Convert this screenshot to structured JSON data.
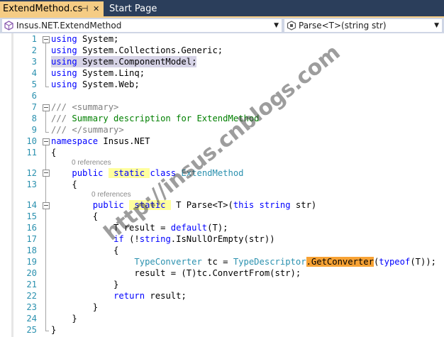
{
  "tabs": [
    {
      "label": "ExtendMethod.cs",
      "active": true,
      "pin_glyph": "⊣",
      "close_glyph": "✕"
    },
    {
      "label": "Start Page",
      "active": false
    }
  ],
  "navbar": {
    "type_dropdown": "Insus.NET.ExtendMethod",
    "member_dropdown": "Parse<T>(string str)"
  },
  "codelens": [
    "0 references",
    "0 references"
  ],
  "watermark": "http://insus.cnblogs.com",
  "colors": {
    "keyword": "#0000ff",
    "type": "#2b91af",
    "comment": "#008000",
    "line_number": "#2b91af",
    "highlight_static": "#ffff9e",
    "highlight_reference": "#f7a234",
    "selected_line": "#d6d3e6"
  },
  "code_lines": [
    {
      "num": "1",
      "tokens": [
        [
          "k",
          "using"
        ],
        [
          "p",
          " System;"
        ]
      ]
    },
    {
      "num": "2",
      "tokens": [
        [
          "k",
          "using"
        ],
        [
          "p",
          " System.Collections.Generic;"
        ]
      ]
    },
    {
      "num": "3",
      "tokens": [
        [
          "k",
          "using"
        ],
        [
          "p",
          " System.ComponentModel;"
        ]
      ]
    },
    {
      "num": "4",
      "tokens": [
        [
          "k",
          "using"
        ],
        [
          "p",
          " System.Linq;"
        ]
      ]
    },
    {
      "num": "5",
      "tokens": [
        [
          "k",
          "using"
        ],
        [
          "p",
          " System.Web;"
        ]
      ]
    },
    {
      "num": "6",
      "tokens": []
    },
    {
      "num": "7",
      "tokens": [
        [
          "cg",
          "///"
        ],
        [
          "c",
          " "
        ],
        [
          "cg",
          "<summary>"
        ]
      ]
    },
    {
      "num": "8",
      "tokens": [
        [
          "cg",
          "///"
        ],
        [
          "c",
          " Summary description for ExtendMethod"
        ]
      ]
    },
    {
      "num": "9",
      "tokens": [
        [
          "cg",
          "///"
        ],
        [
          "c",
          " "
        ],
        [
          "cg",
          "</summary>"
        ]
      ]
    },
    {
      "num": "10",
      "tokens": [
        [
          "k",
          "namespace"
        ],
        [
          "p",
          " Insus.NET"
        ]
      ]
    },
    {
      "num": "11",
      "tokens": [
        [
          "p",
          "{"
        ]
      ]
    },
    {
      "num": "12",
      "tokens": [
        [
          "p",
          "    "
        ],
        [
          "k",
          "public"
        ],
        [
          "p",
          " "
        ],
        [
          "ks",
          " static "
        ],
        [
          "k",
          "class"
        ],
        [
          "p",
          " "
        ],
        [
          "t",
          "ExtendMethod"
        ]
      ]
    },
    {
      "num": "13",
      "tokens": [
        [
          "p",
          "    {"
        ]
      ]
    },
    {
      "num": "14",
      "tokens": [
        [
          "p",
          "        "
        ],
        [
          "k",
          "public"
        ],
        [
          "p",
          " "
        ],
        [
          "ks",
          " static "
        ],
        [
          "p",
          " T Parse<T>("
        ],
        [
          "k",
          "this"
        ],
        [
          "p",
          " "
        ],
        [
          "k",
          "string"
        ],
        [
          "p",
          " str)"
        ]
      ]
    },
    {
      "num": "15",
      "tokens": [
        [
          "p",
          "        {"
        ]
      ]
    },
    {
      "num": "16",
      "tokens": [
        [
          "p",
          "            T result = "
        ],
        [
          "k",
          "default"
        ],
        [
          "p",
          "(T);"
        ]
      ]
    },
    {
      "num": "17",
      "tokens": [
        [
          "p",
          "            "
        ],
        [
          "k",
          "if"
        ],
        [
          "p",
          " (!"
        ],
        [
          "k",
          "string"
        ],
        [
          "p",
          ".IsNullOrEmpty(str))"
        ]
      ]
    },
    {
      "num": "18",
      "tokens": [
        [
          "p",
          "            {"
        ]
      ]
    },
    {
      "num": "19",
      "tokens": [
        [
          "p",
          "                "
        ],
        [
          "t",
          "TypeConverter"
        ],
        [
          "p",
          " tc = "
        ],
        [
          "t",
          "TypeDescriptor"
        ],
        [
          "oh",
          ".GetConverter"
        ],
        [
          "p",
          "("
        ],
        [
          "k",
          "typeof"
        ],
        [
          "p",
          "(T));"
        ]
      ]
    },
    {
      "num": "20",
      "tokens": [
        [
          "p",
          "                result = (T)tc.ConvertFrom(str);"
        ]
      ]
    },
    {
      "num": "21",
      "tokens": [
        [
          "p",
          "            }"
        ]
      ]
    },
    {
      "num": "22",
      "tokens": [
        [
          "p",
          "            "
        ],
        [
          "k",
          "return"
        ],
        [
          "p",
          " result;"
        ]
      ]
    },
    {
      "num": "23",
      "tokens": [
        [
          "p",
          "        }"
        ]
      ]
    },
    {
      "num": "24",
      "tokens": [
        [
          "p",
          "    }"
        ]
      ]
    },
    {
      "num": "25",
      "tokens": [
        [
          "p",
          "}"
        ]
      ]
    }
  ]
}
